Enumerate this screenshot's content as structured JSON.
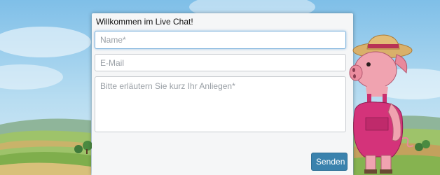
{
  "chat": {
    "title": "Willkommen im Live Chat!",
    "name_placeholder": "Name*",
    "email_placeholder": "E-Mail",
    "message_placeholder": "Bitte erläutern Sie kurz Ihr Anliegen*",
    "send_label": "Senden"
  },
  "colors": {
    "sky_top": "#8ec7ea",
    "send_button": "#3a82ad",
    "pig_body": "#e26e8a",
    "overalls": "#d4337a"
  },
  "icons": [
    "pig-mascot-illustration",
    "farm-landscape-background"
  ]
}
